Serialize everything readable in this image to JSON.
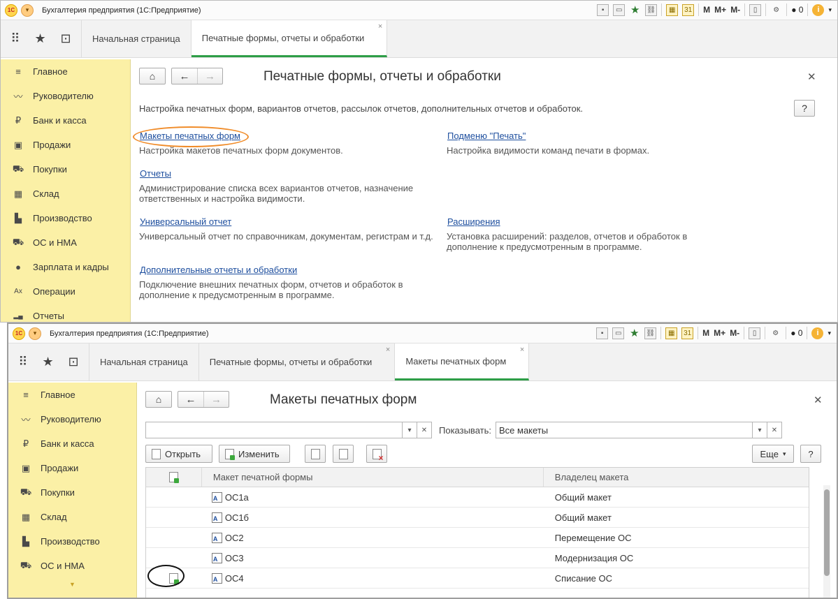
{
  "app_title": "Бухгалтерия предприятия  (1С:Предприятие)",
  "logo_text": "1С",
  "toolbar_text": [
    "M",
    "M+",
    "M-"
  ],
  "user_count": "0",
  "sidebar_items": [
    {
      "icon": "≡",
      "label": "Главное"
    },
    {
      "icon": "〰",
      "label": "Руководителю"
    },
    {
      "icon": "₽",
      "label": "Банк и касса"
    },
    {
      "icon": "▣",
      "label": "Продажи"
    },
    {
      "icon": "⛟",
      "label": "Покупки"
    },
    {
      "icon": "▦",
      "label": "Склад"
    },
    {
      "icon": "▙",
      "label": "Производство"
    },
    {
      "icon": "⛟",
      "label": "ОС и НМА"
    },
    {
      "icon": "●",
      "label": "Зарплата и кадры"
    },
    {
      "icon": "Ax",
      "label": "Операции"
    },
    {
      "icon": "▂▄",
      "label": "Отчеты"
    }
  ],
  "window1": {
    "tabs": [
      {
        "label": "Начальная страница"
      },
      {
        "label": "Печатные формы, отчеты и обработки"
      }
    ],
    "page_title": "Печатные формы, отчеты и обработки",
    "intro": "Настройка печатных форм, вариантов отчетов, рассылок отчетов, дополнительных отчетов и обработок.",
    "help": "?",
    "links": [
      {
        "title": "Макеты печатных форм",
        "desc": "Настройка макетов печатных форм документов."
      },
      {
        "title": "Отчеты",
        "desc": "Администрирование списка всех вариантов отчетов, назначение ответственных и настройка видимости."
      },
      {
        "title": "Универсальный отчет",
        "desc": "Универсальный отчет по справочникам, документам, регистрам и т.д."
      },
      {
        "title": "Дополнительные отчеты и обработки",
        "desc": "Подключение внешних печатных форм, отчетов и обработок в дополнение к предусмотренным в программе."
      },
      {
        "title": "Подменю \"Печать\"",
        "desc": "Настройка видимости команд печати в формах."
      },
      {
        "title": "Расширения",
        "desc": "Установка расширений: разделов, отчетов и обработок в дополнение к предусмотренным в программе."
      }
    ]
  },
  "window2": {
    "tabs": [
      {
        "label": "Начальная страница"
      },
      {
        "label": "Печатные формы, отчеты и обработки"
      },
      {
        "label": "Макеты печатных форм"
      }
    ],
    "page_title": "Макеты печатных форм",
    "show_label": "Показывать:",
    "show_value": "Все макеты",
    "filter_value": "",
    "buttons": {
      "open": "Открыть",
      "edit": "Изменить",
      "more": "Еще",
      "help": "?"
    },
    "columns": {
      "template": "Макет печатной формы",
      "owner": "Владелец макета"
    },
    "rows": [
      {
        "name": "ОС1а",
        "owner": "Общий макет",
        "changed": false
      },
      {
        "name": "ОС1б",
        "owner": "Общий макет",
        "changed": false
      },
      {
        "name": "ОС2",
        "owner": "Перемещение ОС",
        "changed": false
      },
      {
        "name": "ОС3",
        "owner": "Модернизация ОС",
        "changed": false
      },
      {
        "name": "ОС4",
        "owner": "Списание ОС",
        "changed": true
      }
    ]
  }
}
